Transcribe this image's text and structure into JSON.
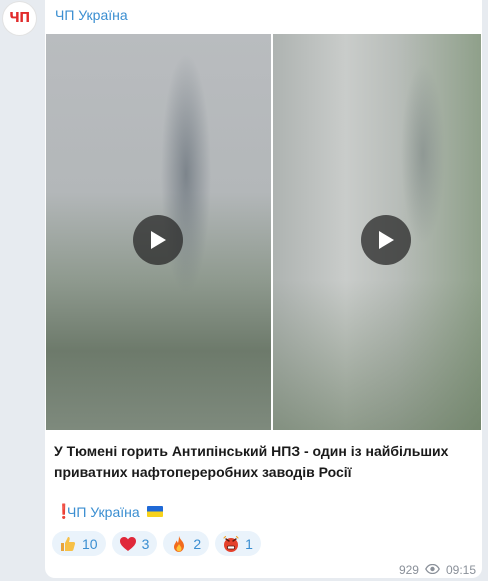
{
  "channel": {
    "avatar_text": "ЧП",
    "name": "ЧП Україна"
  },
  "media": {
    "videos": [
      {
        "label": "video-1"
      },
      {
        "label": "video-2"
      }
    ]
  },
  "post": {
    "caption": "У Тюмені горить Антипінський НПЗ - один із найбільших приватних нафтопереробних заводів Росії",
    "signature_mark": "❗",
    "signature_link": "ЧП Україна"
  },
  "reactions": [
    {
      "icon": "thumbs-up-icon",
      "count": "10"
    },
    {
      "icon": "heart-icon",
      "count": "3"
    },
    {
      "icon": "fire-icon",
      "count": "2"
    },
    {
      "icon": "angry-face-icon",
      "count": "1"
    }
  ],
  "meta": {
    "views": "929",
    "time": "09:15"
  },
  "colors": {
    "accent": "#3a8ed1",
    "brand_red": "#e12b2b",
    "reaction_bg": "#eaf3fb"
  }
}
